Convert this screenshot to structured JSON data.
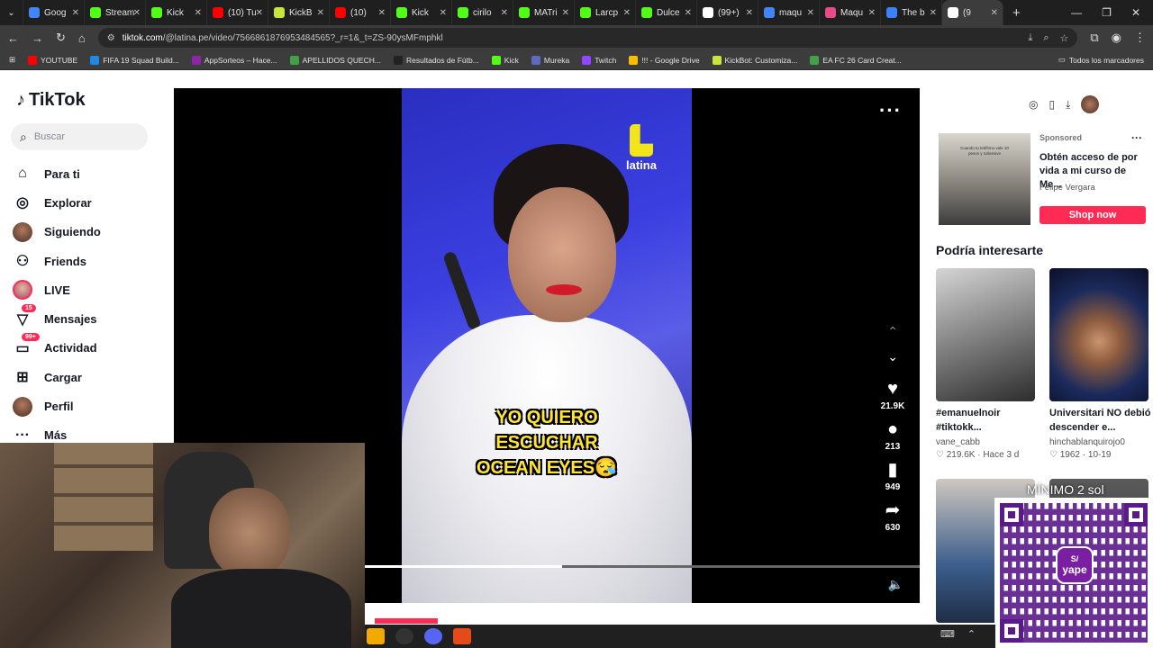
{
  "browser": {
    "tabs": [
      {
        "label": "Goog",
        "color": "#4285f4",
        "active": false
      },
      {
        "label": "Stream",
        "color": "#53fc18",
        "active": false
      },
      {
        "label": "Kick",
        "color": "#53fc18",
        "active": false
      },
      {
        "label": "(10) Tu",
        "color": "#ff0000",
        "active": false
      },
      {
        "label": "KickB",
        "color": "#c6e63a",
        "active": false
      },
      {
        "label": "(10)",
        "color": "#ff0000",
        "active": false
      },
      {
        "label": "Kick",
        "color": "#53fc18",
        "active": false
      },
      {
        "label": "cirilo",
        "color": "#53fc18",
        "active": false
      },
      {
        "label": "MATri",
        "color": "#53fc18",
        "active": false
      },
      {
        "label": "Larcp",
        "color": "#53fc18",
        "active": false
      },
      {
        "label": "Dulce",
        "color": "#53fc18",
        "active": false
      },
      {
        "label": "(99+)",
        "color": "#ffffff",
        "active": false
      },
      {
        "label": "maqu",
        "color": "#4285f4",
        "active": false
      },
      {
        "label": "Maqu",
        "color": "#e94b8a",
        "active": false
      },
      {
        "label": "The b",
        "color": "#3b82f6",
        "active": false
      },
      {
        "label": "(9",
        "color": "#ffffff",
        "active": true
      }
    ],
    "new_tab": "+",
    "url_host": "tiktok.com",
    "url_path": "/@latina.pe/video/7566861876953484565?_r=1&_t=ZS-90ysMFmphkl",
    "bookmarks": [
      {
        "label": "YOUTUBE",
        "color": "#ff0000"
      },
      {
        "label": "FIFA 19 Squad Build...",
        "color": "#1e88e5"
      },
      {
        "label": "AppSorteos – Hace...",
        "color": "#8e24aa"
      },
      {
        "label": "APELLIDOS QUECH...",
        "color": "#43a047"
      },
      {
        "label": "Resultados de Fútb...",
        "color": "#222222"
      },
      {
        "label": "Kick",
        "color": "#53fc18"
      },
      {
        "label": "Mureka",
        "color": "#5c6bc0"
      },
      {
        "label": "Twitch",
        "color": "#9146ff"
      },
      {
        "label": "!!! - Google Drive",
        "color": "#fbbc04"
      },
      {
        "label": "KickBot: Customiza...",
        "color": "#c6e63a"
      },
      {
        "label": "EA FC 26 Card Creat...",
        "color": "#43a047"
      }
    ],
    "all_bookmarks": "Todos los marcadores"
  },
  "sidebar": {
    "logo": "TikTok",
    "search_placeholder": "Buscar",
    "items": [
      {
        "label": "Para ti",
        "icon": "home-icon",
        "glyph": "⌂"
      },
      {
        "label": "Explorar",
        "icon": "compass-icon",
        "glyph": "◎"
      },
      {
        "label": "Siguiendo",
        "icon": "following-avatar-icon",
        "glyph": ""
      },
      {
        "label": "Friends",
        "icon": "friends-icon",
        "glyph": "⚇"
      },
      {
        "label": "LIVE",
        "icon": "live-avatar-icon",
        "glyph": ""
      },
      {
        "label": "Mensajes",
        "icon": "messages-icon",
        "glyph": "▽",
        "badge": "15"
      },
      {
        "label": "Actividad",
        "icon": "activity-icon",
        "glyph": "▭",
        "badge": "99+"
      },
      {
        "label": "Cargar",
        "icon": "upload-icon",
        "glyph": "⊞"
      },
      {
        "label": "Perfil",
        "icon": "profile-avatar-icon",
        "glyph": ""
      },
      {
        "label": "Más",
        "icon": "more-icon",
        "glyph": "···"
      }
    ]
  },
  "video": {
    "channel_logo_text": "latina",
    "caption_lines": [
      "YO QUIERO",
      "ESCUCHAR",
      "OCEAN EYES😪"
    ],
    "progress": 0.355,
    "likes": "21.9K",
    "comments": "213",
    "saves": "949",
    "shares": "630"
  },
  "ad": {
    "sponsored": "Sponsored",
    "title": "Obtén acceso de por vida a mi curso de Me...",
    "author": "Felipe Vergara",
    "cta": "Shop now",
    "thumb_text": "Cuando tu teléfono vale 10 pesos y sobrevive"
  },
  "recommendations": {
    "title": "Podría interesarte",
    "items": [
      {
        "title": "#emanuelnoir #tiktokk...",
        "user": "vane_cabb",
        "meta": "♡ 219.6K · Hace 3 d"
      },
      {
        "title": "Universitari NO debió descender e...",
        "user": "hinchablanquirojo0",
        "meta": "♡ 1962 · 10-19"
      }
    ],
    "row2_overlay": "MÍNIMO 2 sol"
  },
  "overlay": {
    "yape_label": "yape",
    "yape_symbol": "S/"
  }
}
